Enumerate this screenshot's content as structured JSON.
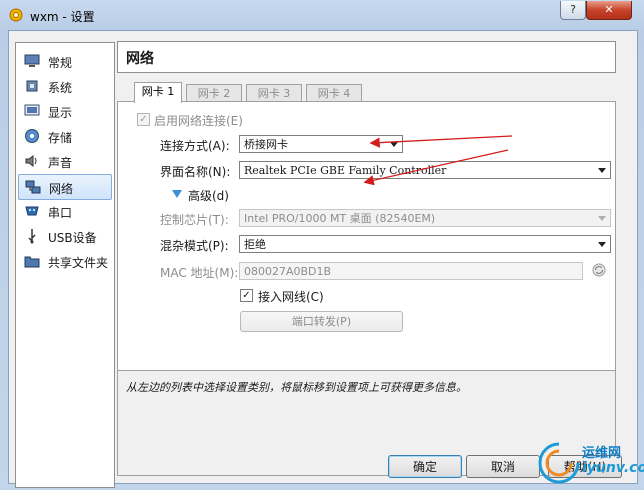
{
  "window": {
    "title": "wxm - 设置",
    "help_glyph": "?",
    "close_glyph": "✕"
  },
  "sidebar": {
    "items": [
      {
        "label": "常规",
        "icon": "monitor-icon"
      },
      {
        "label": "系统",
        "icon": "chip-icon"
      },
      {
        "label": "显示",
        "icon": "display-icon"
      },
      {
        "label": "存储",
        "icon": "disk-icon"
      },
      {
        "label": "声音",
        "icon": "speaker-icon"
      },
      {
        "label": "网络",
        "icon": "network-icon"
      },
      {
        "label": "串口",
        "icon": "serial-port-icon"
      },
      {
        "label": "USB设备",
        "icon": "usb-icon"
      },
      {
        "label": "共享文件夹",
        "icon": "folder-icon"
      }
    ],
    "selected": "网络"
  },
  "page": {
    "title": "网络"
  },
  "tabs": [
    {
      "label": "网卡 1",
      "active": true
    },
    {
      "label": "网卡 2",
      "active": false
    },
    {
      "label": "网卡 3",
      "active": false
    },
    {
      "label": "网卡 4",
      "active": false
    }
  ],
  "form": {
    "enable_label": "启用网络连接(E)",
    "attach_label": "连接方式(A):",
    "attach_value": "桥接网卡",
    "name_label": "界面名称(N):",
    "name_value": "Realtek PCIe GBE Family Controller",
    "advanced_label": "高级(d)",
    "chip_label": "控制芯片(T):",
    "chip_value": "Intel PRO/1000 MT 桌面 (82540EM)",
    "promisc_label": "混杂模式(P):",
    "promisc_value": "拒绝",
    "mac_label": "MAC 地址(M):",
    "mac_value": "080027A0BD1B",
    "cable_label": "接入网线(C)",
    "port_forward_label": "端口转发(P)"
  },
  "info": {
    "text": "从左边的列表中选择设置类别，将鼠标移到设置项上可获得更多信息。"
  },
  "buttons": {
    "ok": "确定",
    "cancel": "取消",
    "help": "帮助(H)"
  },
  "watermark": {
    "brand": "运维网",
    "url": "iyunv.com"
  },
  "colors": {
    "accent": "#3c7fb1",
    "annotation_arrow": "#d21d1d",
    "selection": "#cfe4fb"
  }
}
